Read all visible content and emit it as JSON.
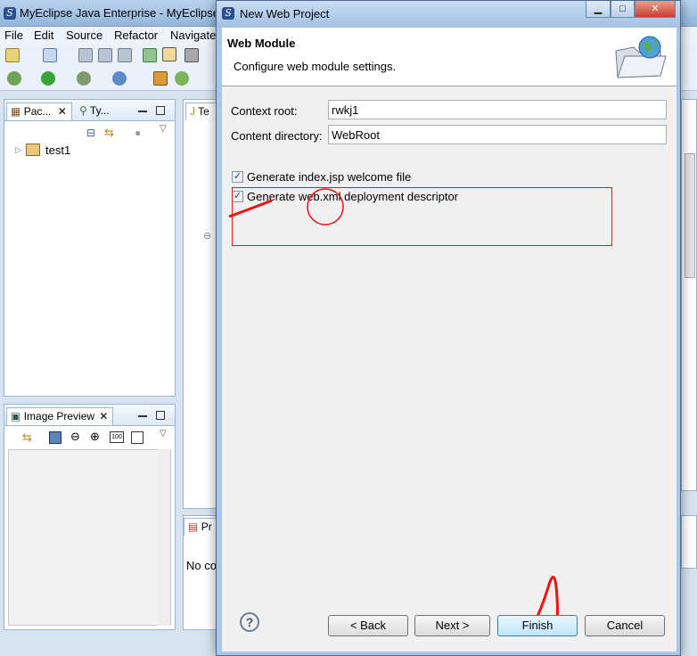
{
  "ide": {
    "title": "MyEclipse Java Enterprise - MyEclipse",
    "menu": [
      "File",
      "Edit",
      "Source",
      "Refactor",
      "Navigate"
    ],
    "package_tabs": [
      "Pac...",
      "Ty..."
    ],
    "tree_item": "test1",
    "editor_tab": "Te",
    "image_preview_tab": "Image Preview",
    "problems_tab": "Pr",
    "problems_text": "No co"
  },
  "dialog": {
    "title": "New Web Project",
    "header_title": "Web Module",
    "header_subtitle": "Configure web module settings.",
    "fields": {
      "context_root_label": "Context root:",
      "context_root_value": "rwkj1",
      "content_dir_label": "Content directory:",
      "content_dir_value": "WebRoot"
    },
    "checkboxes": [
      {
        "label": "Generate index.jsp welcome file",
        "checked": true
      },
      {
        "label": "Generate web.xml deployment descriptor",
        "checked": true
      }
    ],
    "buttons": {
      "help": "?",
      "back": "< Back",
      "next": "Next >",
      "finish": "Finish",
      "cancel": "Cancel"
    }
  },
  "colors": {
    "annotation": "#e11111",
    "finish_button_border": "#3c7fb1"
  }
}
